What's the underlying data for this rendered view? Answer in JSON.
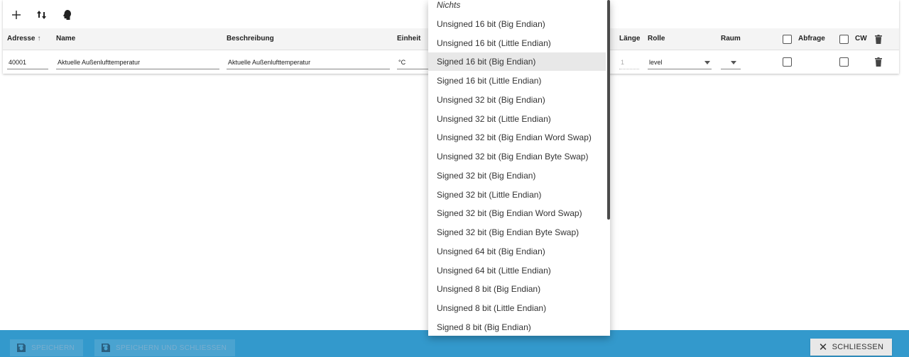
{
  "toolbar": {
    "add_icon": "plus-icon",
    "sort_icon": "sort-arrows-icon",
    "head_icon": "head-profile-icon"
  },
  "table": {
    "columns": {
      "address": "Adresse",
      "address_sort": "↑",
      "name": "Name",
      "description": "Beschreibung",
      "unit": "Einheit",
      "length": "Länge",
      "role": "Rolle",
      "room": "Raum",
      "poll": "Abfrage",
      "cw": "CW"
    },
    "row": {
      "address": "40001",
      "name": "Aktuelle Außenlufttemperatur",
      "description": "Aktuelle Außenlufttemperatur",
      "unit": "°C",
      "length": "1",
      "role": "level",
      "room": ""
    }
  },
  "dropdown": {
    "items": [
      "Nichts",
      "Unsigned 16 bit (Big Endian)",
      "Unsigned 16 bit (Little Endian)",
      "Signed 16 bit (Big Endian)",
      "Signed 16 bit (Little Endian)",
      "Unsigned 32 bit (Big Endian)",
      "Unsigned 32 bit (Little Endian)",
      "Unsigned 32 bit (Big Endian Word Swap)",
      "Unsigned 32 bit (Big Endian Byte Swap)",
      "Signed 32 bit (Big Endian)",
      "Signed 32 bit (Little Endian)",
      "Signed 32 bit (Big Endian Word Swap)",
      "Signed 32 bit (Big Endian Byte Swap)",
      "Unsigned 64 bit (Big Endian)",
      "Unsigned 64 bit (Little Endian)",
      "Unsigned 8 bit (Big Endian)",
      "Unsigned 8 bit (Little Endian)",
      "Signed 8 bit (Big Endian)"
    ],
    "selected": "Signed 16 bit (Big Endian)"
  },
  "footer": {
    "save_label": "SPEICHERN",
    "save_close_label": "SPEICHERN UND SCHLIESSEN",
    "close_label": "SCHLIESSEN",
    "bar_color": "#3399cc"
  }
}
